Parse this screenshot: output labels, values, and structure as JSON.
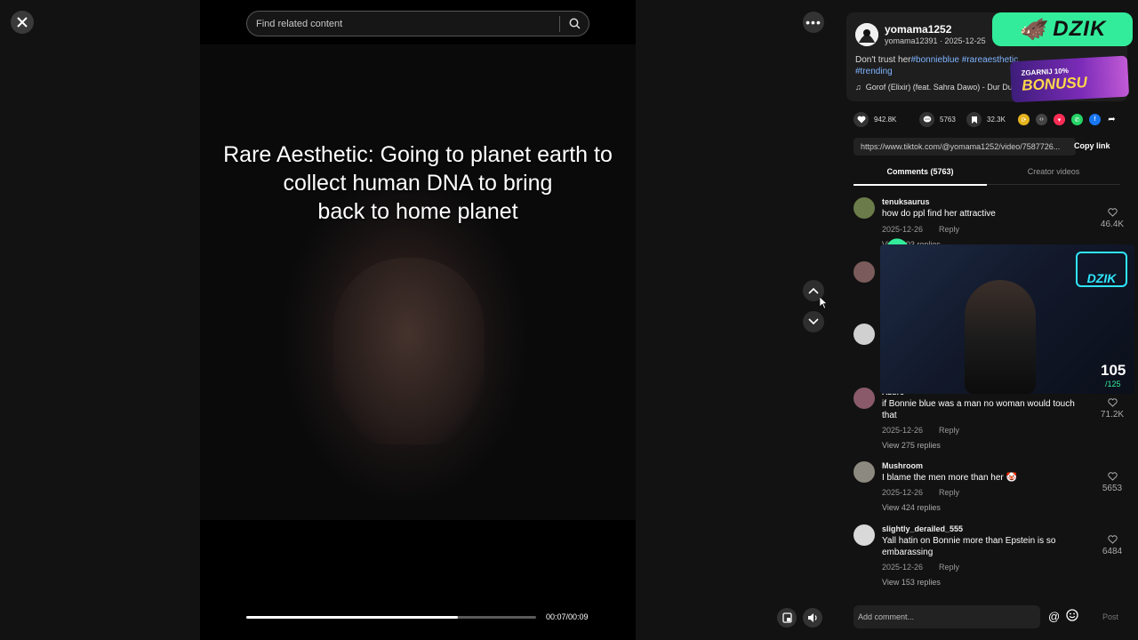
{
  "player": {
    "caption_lines": [
      "Rare Aesthetic: Going to planet earth to",
      "collect human DNA to bring",
      "back to home planet"
    ],
    "search_placeholder": "Find related content",
    "time": "00:07/00:09",
    "progress": 0.73
  },
  "post": {
    "username": "yomama1252",
    "subline": "yomama12391 · 2025-12-25",
    "desc_text": "Don't trust her",
    "tags": [
      "#bonnieblue",
      "#rareaesthetic",
      "#trending"
    ],
    "music": "Gorof (Elixir) (feat. Sahra Dawo) - Dur Dur",
    "likes": "942.8K",
    "comments": "5763",
    "saves": "32.3K",
    "link": "https://www.tiktok.com/@yomama1252/video/7587726...",
    "copy_label": "Copy link"
  },
  "tabs": {
    "comments": "Comments (5763)",
    "creator": "Creator videos"
  },
  "comments": [
    {
      "user": "tenuksaurus",
      "text": "how do ppl find her attractive",
      "date": "2025-12-26",
      "reply": "Reply",
      "likes": "46.4K",
      "view": "View 103 replies",
      "avatar": "#6b7c4a"
    },
    {
      "user": "Azure",
      "text": "if Bonnie blue was a man no woman would touch that",
      "date": "2025-12-26",
      "reply": "Reply",
      "likes": "71.2K",
      "view": "View 275 replies",
      "avatar": "#8a5a6a"
    },
    {
      "user": "Mushroom",
      "text": "I blame the men more than her 🤡",
      "date": "2025-12-26",
      "reply": "Reply",
      "likes": "5653",
      "view": "View 424 replies",
      "avatar": "#8c8a80"
    },
    {
      "user": "slightly_derailed_555",
      "text": "Yall hatin on Bonnie more than Epstein is so embarassing",
      "date": "2025-12-26",
      "reply": "Reply",
      "likes": "6484",
      "view": "View 153 replies",
      "avatar": "#d9d9d9"
    }
  ],
  "add_comment_placeholder": "Add comment...",
  "post_label": "Post",
  "ads": {
    "logo": "DZIK",
    "bonus_line1": "ZGARNIJ 10%",
    "bonus_line2": "BONUSU",
    "cam_brand": "DZIK",
    "cam_count": "105",
    "cam_total": "/125"
  }
}
